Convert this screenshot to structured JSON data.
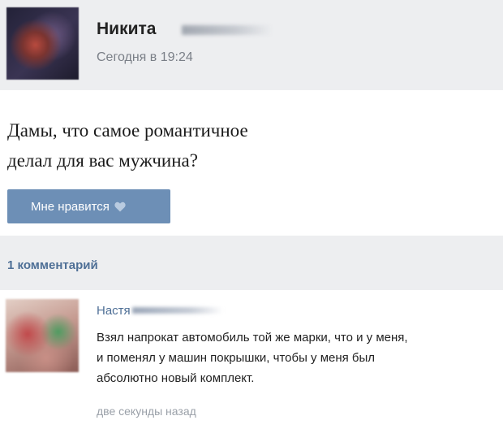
{
  "post": {
    "author": "Никита",
    "time": "Сегодня в 19:24",
    "text_lines": [
      "Дамы, что самое романтичное",
      "делал для вас мужчина?"
    ]
  },
  "like_button": {
    "label": "Мне нравится",
    "icon": "heart-icon"
  },
  "comments": {
    "count_label": "1 комментарий",
    "items": [
      {
        "author": "Настя",
        "text_lines": [
          "Взял напрокат автомобиль той же марки, что и у меня,",
          "и поменял у машин покрышки, чтобы у меня был",
          "абсолютно новый комплект."
        ],
        "time": "две секунды назад"
      }
    ]
  },
  "colors": {
    "accent": "#6d8fb6",
    "link": "#4e6f96",
    "panel": "#edeef0"
  }
}
